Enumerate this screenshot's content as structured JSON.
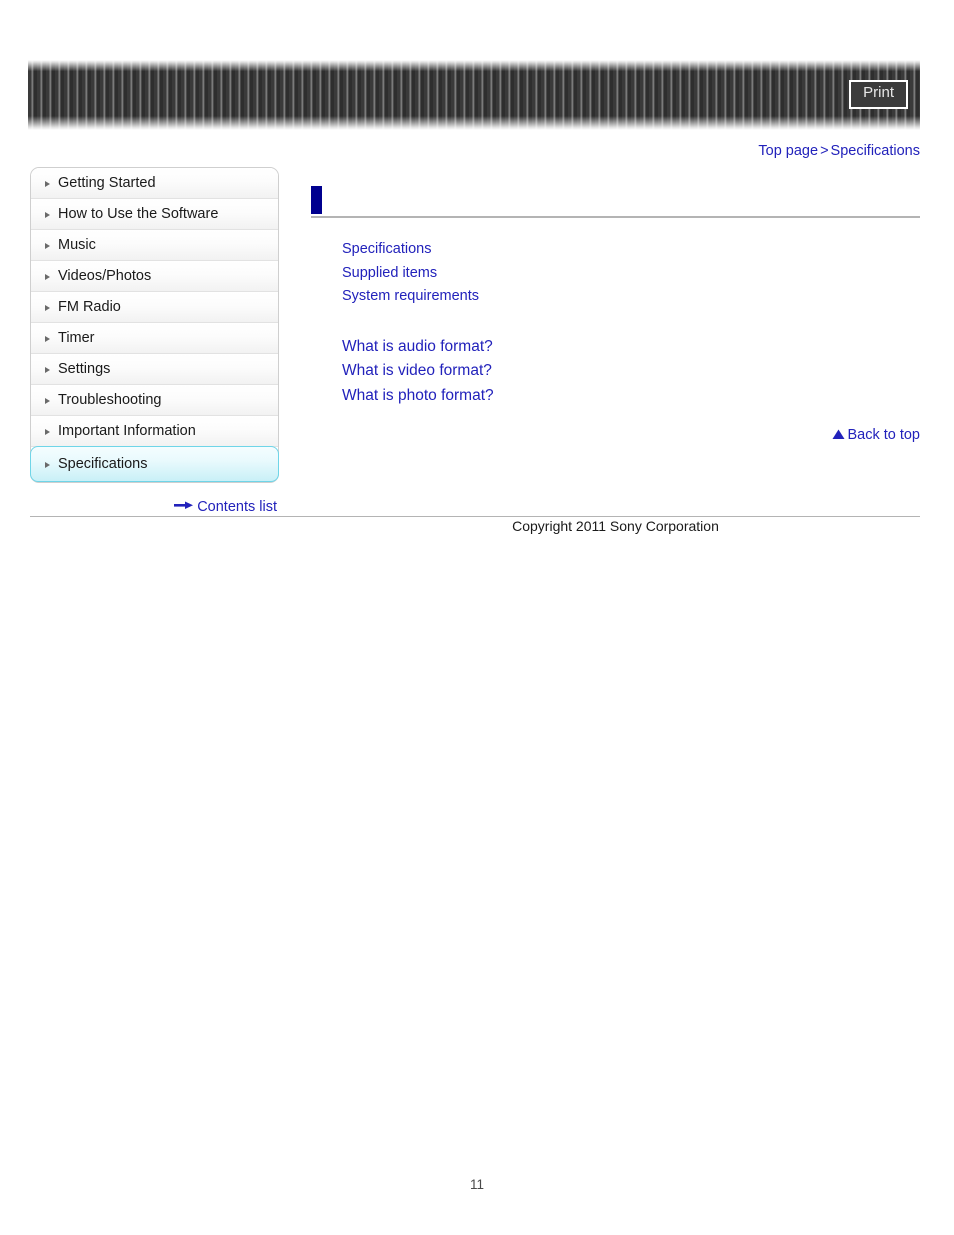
{
  "header": {
    "print_label": "Print"
  },
  "breadcrumb": {
    "top_label": "Top page",
    "separator": ">",
    "current_label": "Specifications"
  },
  "sidebar": {
    "items": [
      {
        "label": "Getting Started",
        "selected": false
      },
      {
        "label": "How to Use the Software",
        "selected": false
      },
      {
        "label": "Music",
        "selected": false
      },
      {
        "label": "Videos/Photos",
        "selected": false
      },
      {
        "label": "FM Radio",
        "selected": false
      },
      {
        "label": "Timer",
        "selected": false
      },
      {
        "label": "Settings",
        "selected": false
      },
      {
        "label": "Troubleshooting",
        "selected": false
      },
      {
        "label": "Important Information",
        "selected": false
      },
      {
        "label": "Specifications",
        "selected": true
      }
    ],
    "contents_list_label": "Contents list"
  },
  "main": {
    "page_title": "",
    "link_groups": [
      {
        "links": [
          "Specifications",
          "Supplied items",
          "System requirements"
        ]
      },
      {
        "links": [
          "What is audio format?",
          "What is video format?",
          "What is photo format?"
        ]
      }
    ],
    "back_to_top_label": "Back to top"
  },
  "footer": {
    "copyright": "Copyright 2011 Sony Corporation",
    "page_number": "11"
  },
  "colors": {
    "link_blue": "#2222bb",
    "title_marker": "#00008f",
    "selected_border": "#6fd5e8",
    "rule_gray": "#b4b4b4"
  }
}
